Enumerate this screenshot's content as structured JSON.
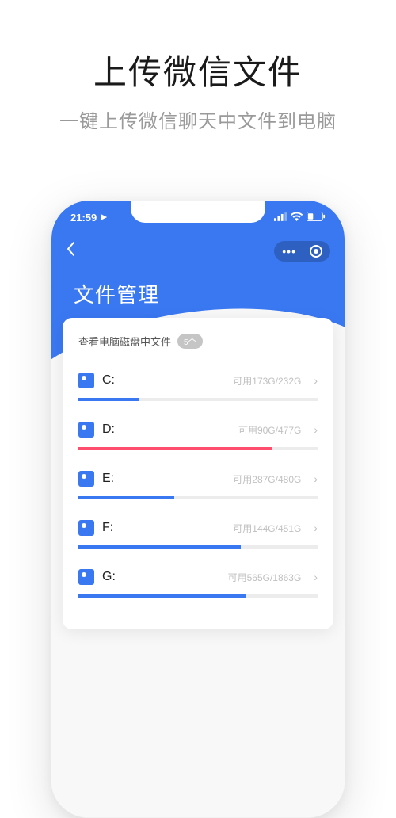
{
  "marketing": {
    "title": "上传微信文件",
    "subtitle": "一键上传微信聊天中文件到电脑"
  },
  "status_bar": {
    "time": "21:59"
  },
  "screen": {
    "title": "文件管理",
    "card_header": "查看电脑磁盘中文件",
    "count_badge": "5个"
  },
  "disks": [
    {
      "name": "C:",
      "label": "可用173G/232G",
      "percent": 25,
      "color": "blue"
    },
    {
      "name": "D:",
      "label": "可用90G/477G",
      "percent": 81,
      "color": "red"
    },
    {
      "name": "E:",
      "label": "可用287G/480G",
      "percent": 40,
      "color": "blue"
    },
    {
      "name": "F:",
      "label": "可用144G/451G",
      "percent": 68,
      "color": "blue"
    },
    {
      "name": "G:",
      "label": "可用565G/1863G",
      "percent": 70,
      "color": "blue"
    }
  ]
}
